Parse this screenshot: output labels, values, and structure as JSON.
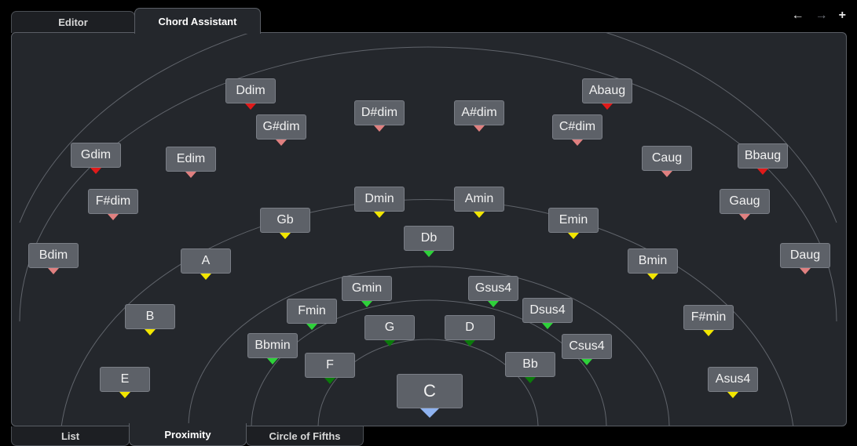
{
  "top_tabs": {
    "editor": "Editor",
    "chord_assistant": "Chord Assistant"
  },
  "bottom_tabs": {
    "list": "List",
    "proximity": "Proximity",
    "circle_of_fifths": "Circle of Fifths"
  },
  "nav_icons": {
    "back": "arrow-left-icon",
    "forward": "arrow-right-icon",
    "add": "plus-icon"
  },
  "marker_colors": {
    "red": "#e01a1a",
    "pink": "#e08080",
    "yellow": "#f2e600",
    "lime": "#2ed13a",
    "dark_green": "#0b7a0b",
    "blue": "#8fb3f0"
  },
  "chords": {
    "center": "C",
    "ring1": {
      "f": "F",
      "g": "G",
      "d": "D",
      "bb": "Bb"
    },
    "ring2": {
      "bbmin": "Bbmin",
      "fmin": "Fmin",
      "gmin": "Gmin",
      "gsus4": "Gsus4",
      "dsus4": "Dsus4",
      "csus4": "Csus4"
    },
    "ring3": {
      "e": "E",
      "b": "B",
      "a": "A",
      "gb": "Gb",
      "db": "Db",
      "dmin": "Dmin",
      "amin": "Amin",
      "emin": "Emin",
      "bmin": "Bmin",
      "fsharpmin": "F#min",
      "asus4": "Asus4"
    },
    "ring4": {
      "fsharpdim": "F#dim",
      "edim": "Edim",
      "gsharpdim": "G#dim",
      "dsharpdim": "D#dim",
      "asharpdim": "A#dim",
      "csharpdim": "C#dim",
      "caug": "Caug",
      "gaug": "Gaug"
    },
    "ring5": {
      "bdim": "Bdim",
      "gdim": "Gdim",
      "ddim": "Ddim",
      "abaug": "Abaug",
      "bbaug": "Bbaug",
      "daug": "Daug"
    }
  }
}
